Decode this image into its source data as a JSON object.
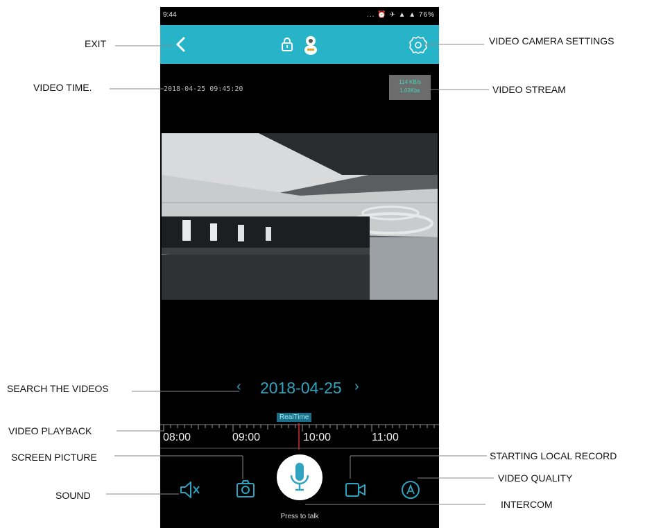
{
  "status_bar": {
    "time": "9:44",
    "icons": "... ⏰ ✈ ▲ ▲ 76%"
  },
  "app_bar": {
    "back_icon": "chevron-left-icon",
    "lock_icon": "lock-icon",
    "avatar_icon": "camera-avatar-icon",
    "settings_icon": "gear-icon",
    "accent": "#27b4c9"
  },
  "video": {
    "timestamp": "2018-04-25 09:45:20",
    "stream_line1": "114 KB/s",
    "stream_line2": "1.02Kbs"
  },
  "search": {
    "date": "2018-04-25",
    "prev": "‹",
    "next": "›"
  },
  "playback": {
    "realtime_label": "RealTime",
    "ticks": [
      "08:00",
      "09:00",
      "10:00",
      "11:00"
    ]
  },
  "controls": {
    "sound_icon": "speaker-muted-icon",
    "snapshot_icon": "camera-icon",
    "mic_icon": "microphone-icon",
    "record_icon": "video-record-icon",
    "quality_icon": "quality-a-icon",
    "press_to_talk": "Press to talk"
  },
  "annotations": {
    "exit": "EXIT",
    "video_camera_settings": "VIDEO CAMERA SETTINGS",
    "video_time": "VIDEO TIME.",
    "video_stream": "VIDEO STREAM",
    "search_videos": "SEARCH THE VIDEOS",
    "video_playback": "VIDEO PLAYBACK",
    "screen_picture": "SCREEN PICTURE",
    "starting_local_record": "STARTING LOCAL RECORD",
    "video_quality": "VIDEO QUALITY",
    "sound": "SOUND",
    "intercom": "INTERCOM"
  }
}
